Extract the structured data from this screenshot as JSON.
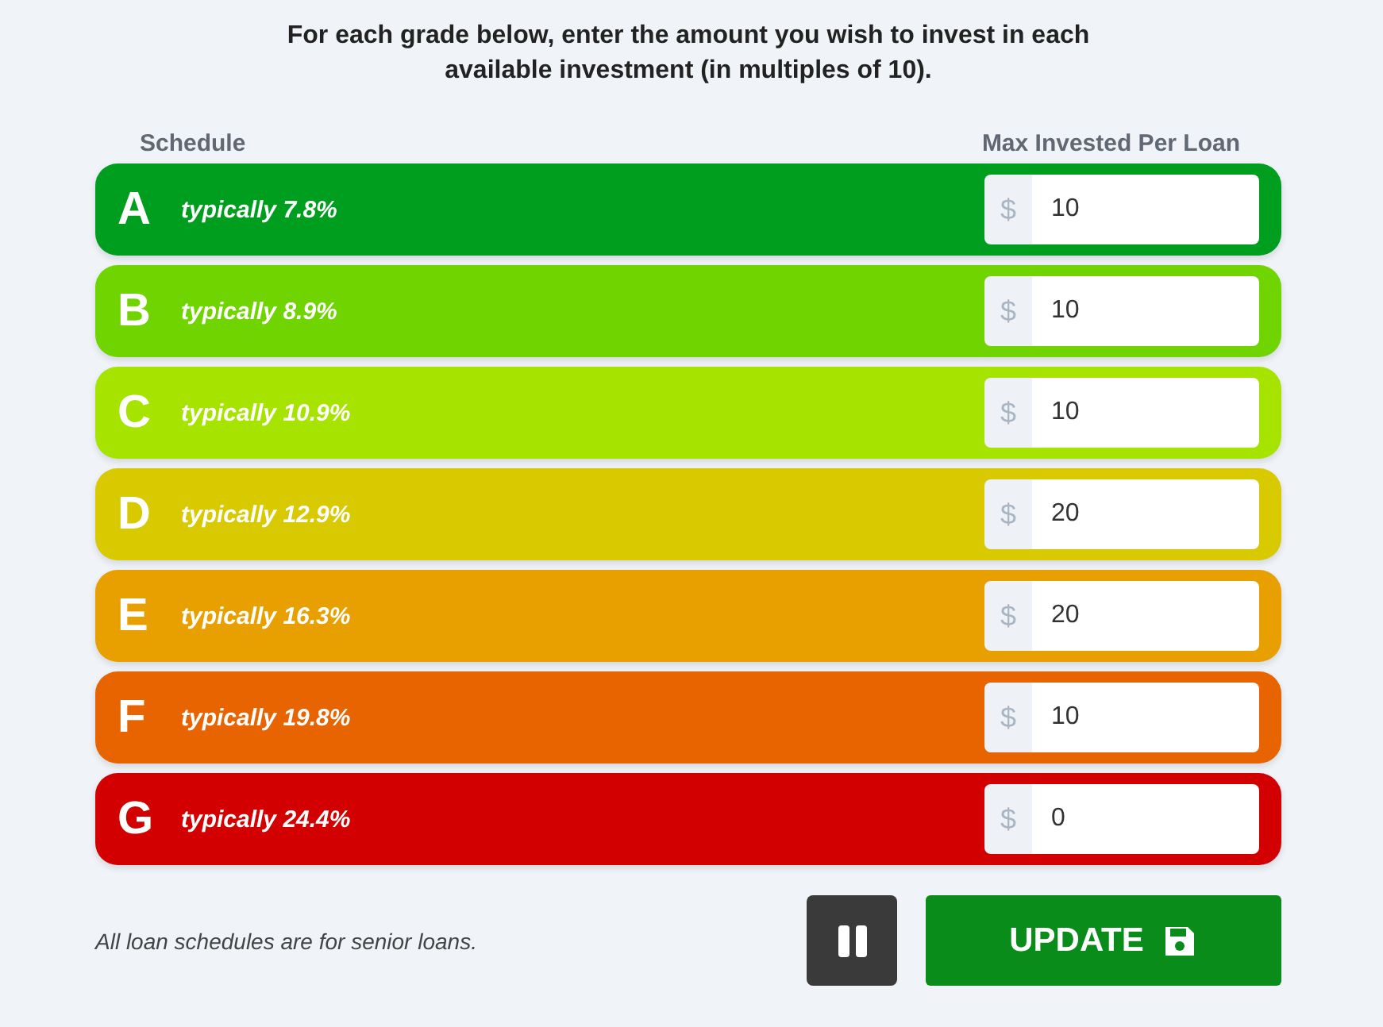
{
  "instructions": "For each grade below, enter the amount you wish to invest in each available investment (in multiples of 10).",
  "columns": {
    "schedule": "Schedule",
    "max": "Max Invested Per Loan"
  },
  "grades": [
    {
      "letter": "A",
      "rate": "typically 7.8%",
      "currency": "$",
      "amount": "10",
      "color": "#009e1f"
    },
    {
      "letter": "B",
      "rate": "typically 8.9%",
      "currency": "$",
      "amount": "10",
      "color": "#6fd400"
    },
    {
      "letter": "C",
      "rate": "typically 10.9%",
      "currency": "$",
      "amount": "10",
      "color": "#a6e400"
    },
    {
      "letter": "D",
      "rate": "typically 12.9%",
      "currency": "$",
      "amount": "20",
      "color": "#d8c900"
    },
    {
      "letter": "E",
      "rate": "typically 16.3%",
      "currency": "$",
      "amount": "20",
      "color": "#e8a000"
    },
    {
      "letter": "F",
      "rate": "typically 19.8%",
      "currency": "$",
      "amount": "10",
      "color": "#e86400"
    },
    {
      "letter": "G",
      "rate": "typically 24.4%",
      "currency": "$",
      "amount": "0",
      "color": "#d20000"
    }
  ],
  "footnote": "All loan schedules are for senior loans.",
  "update_button": "UPDATE"
}
